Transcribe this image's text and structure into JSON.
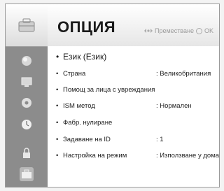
{
  "header": {
    "title": "ОПЦИЯ",
    "hint_move": "Преместване",
    "hint_ok": "OK"
  },
  "sidebar": {
    "icons": [
      "picture-icon",
      "audio-icon",
      "screen-icon",
      "disc-icon",
      "clock-icon",
      "lock-icon",
      "toolbox-icon"
    ]
  },
  "menu": {
    "items": [
      {
        "label": "Език (Език)",
        "value": ""
      },
      {
        "label": "Страна",
        "value": ": Великобритания"
      },
      {
        "label": "Помощ за лица с увреждания",
        "value": ""
      },
      {
        "label": "ISM метод",
        "value": ": Нормален"
      },
      {
        "label": "Фабр. нулиране",
        "value": ""
      },
      {
        "label": "Задаване на ID",
        "value": ": 1"
      },
      {
        "label": "Настройка на режим",
        "value": ": Използване у дома"
      }
    ]
  },
  "bullet": "•"
}
